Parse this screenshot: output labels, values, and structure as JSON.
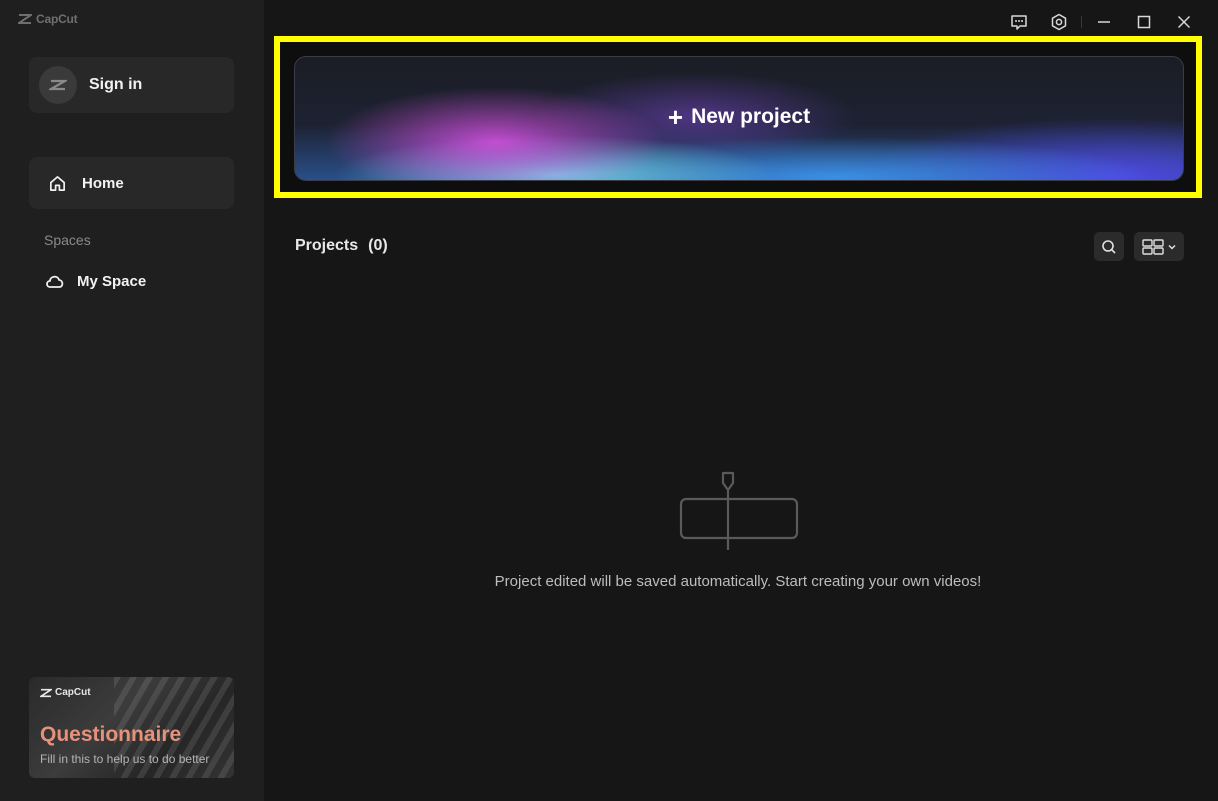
{
  "app": {
    "logo_text": "CapCut"
  },
  "sidebar": {
    "sign_in_label": "Sign in",
    "home_label": "Home",
    "spaces_heading": "Spaces",
    "my_space_label": "My Space",
    "promo": {
      "logo_text": "CapCut",
      "title": "Questionnaire",
      "subtitle": "Fill in this to help us to do better"
    }
  },
  "main": {
    "new_project_label": "New project",
    "projects_title": "Projects",
    "projects_count": "(0)",
    "empty_message": "Project edited will be saved automatically. Start creating your own videos!"
  },
  "colors": {
    "highlight": "#ffff00",
    "promo_title": "#e8917a",
    "sidebar_bg": "#1f1f1f",
    "main_bg": "#161616"
  },
  "icons": {
    "titlebar": [
      "feedback-icon",
      "settings-icon",
      "minimize-icon",
      "maximize-icon",
      "close-icon"
    ],
    "nav": [
      "home-icon",
      "cloud-icon"
    ],
    "toolbar": [
      "search-icon",
      "grid-view-icon",
      "chevron-down-icon"
    ]
  }
}
